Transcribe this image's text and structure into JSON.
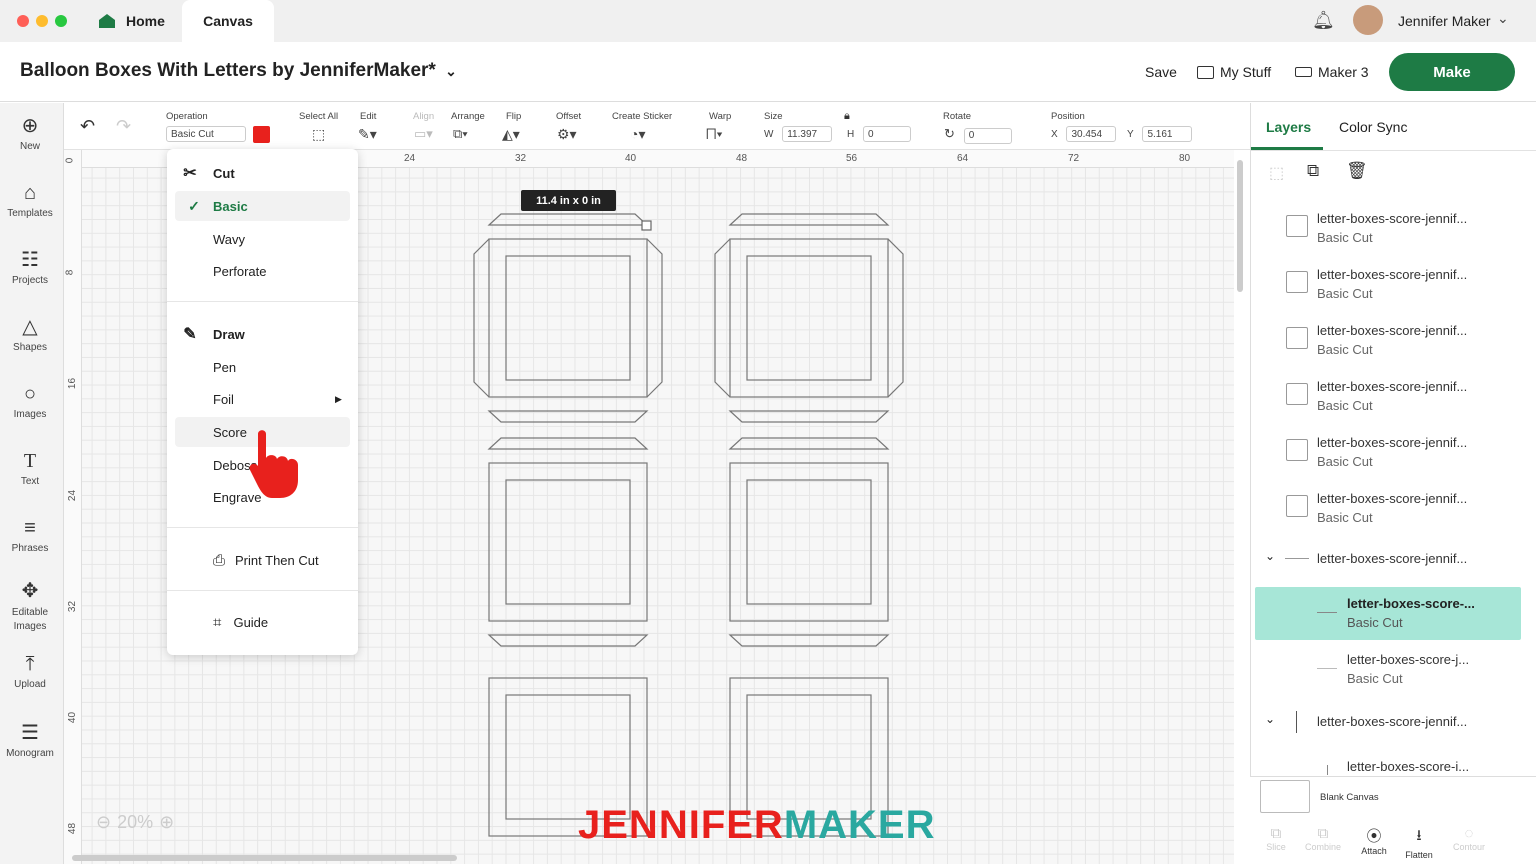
{
  "window": {
    "tabs": [
      {
        "label": "Home"
      },
      {
        "label": "Canvas"
      }
    ],
    "user_name": "Jennifer Maker"
  },
  "header": {
    "project_title": "Balloon Boxes With Letters by JenniferMaker*",
    "save_label": "Save",
    "mystuff_label": "My Stuff",
    "machine_label": "Maker 3",
    "make_label": "Make"
  },
  "sidebar": {
    "items": [
      {
        "label": "New",
        "icon": "plus-circle-icon"
      },
      {
        "label": "Templates",
        "icon": "shirt-icon"
      },
      {
        "label": "Projects",
        "icon": "clipboard-icon"
      },
      {
        "label": "Shapes",
        "icon": "shapes-icon"
      },
      {
        "label": "Images",
        "icon": "balloon-icon"
      },
      {
        "label": "Text",
        "icon": "text-icon"
      },
      {
        "label": "Phrases",
        "icon": "speech-bubble-icon"
      },
      {
        "label": "Editable",
        "label2": "Images",
        "icon": "editable-images-icon"
      },
      {
        "label": "Upload",
        "icon": "upload-icon"
      },
      {
        "label": "Monogram",
        "icon": "monogram-icon"
      }
    ]
  },
  "toolbar": {
    "operation_label": "Operation",
    "operation_value": "Basic Cut",
    "operation_color": "#e8211d",
    "select_all_label": "Select All",
    "edit_label": "Edit",
    "align_label": "Align",
    "arrange_label": "Arrange",
    "flip_label": "Flip",
    "offset_label": "Offset",
    "create_sticker_label": "Create Sticker",
    "warp_label": "Warp",
    "size_label": "Size",
    "width_prefix": "W",
    "width_value": "11.397",
    "height_prefix": "H",
    "height_value": "0",
    "rotate_label": "Rotate",
    "rotate_value": "0",
    "position_label": "Position",
    "x_prefix": "X",
    "x_value": "30.454",
    "y_prefix": "Y",
    "y_value": "5.161"
  },
  "rulers": {
    "top": [
      "24",
      "32",
      "40",
      "48",
      "56",
      "64",
      "72",
      "80"
    ],
    "left": [
      "0",
      "8",
      "16",
      "24",
      "32",
      "40",
      "48"
    ]
  },
  "canvas": {
    "tooltip": "11.4  in x 0  in",
    "zoom": "20%"
  },
  "operation_menu": {
    "cut_header": "Cut",
    "cut_items": [
      "Basic",
      "Wavy",
      "Perforate"
    ],
    "selected": "Basic",
    "draw_header": "Draw",
    "draw_items": [
      "Pen",
      "Foil",
      "Score",
      "Deboss",
      "Engrave"
    ],
    "hovered": "Score",
    "print_then_cut": "Print Then Cut",
    "guide": "Guide"
  },
  "layers_panel": {
    "tabs": [
      "Layers",
      "Color Sync"
    ],
    "active_tab": "Layers",
    "layers": [
      {
        "name": "letter-boxes-score-jennif...",
        "op": "Basic Cut"
      },
      {
        "name": "letter-boxes-score-jennif...",
        "op": "Basic Cut"
      },
      {
        "name": "letter-boxes-score-jennif...",
        "op": "Basic Cut"
      },
      {
        "name": "letter-boxes-score-jennif...",
        "op": "Basic Cut"
      },
      {
        "name": "letter-boxes-score-jennif...",
        "op": "Basic Cut"
      },
      {
        "name": "letter-boxes-score-jennif...",
        "op": "Basic Cut"
      }
    ],
    "group1_name": "letter-boxes-score-jennif...",
    "group1_children": [
      {
        "name": "letter-boxes-score-...",
        "op": "Basic Cut"
      },
      {
        "name": "letter-boxes-score-j...",
        "op": "Basic Cut"
      }
    ],
    "group2_name": "letter-boxes-score-jennif...",
    "group2_child": "letter-boxes-score-i...",
    "blank_canvas": "Blank Canvas",
    "bottom_actions": [
      "Slice",
      "Combine",
      "Attach",
      "Flatten",
      "Contour"
    ]
  },
  "watermark": {
    "part1": "JENNIFER",
    "part2": "MAKER",
    "color1": "#e8211d",
    "color2": "#2aa8a0"
  },
  "colors": {
    "accent_green": "#1e7b45",
    "selected_layer": "#a7e6d7"
  }
}
